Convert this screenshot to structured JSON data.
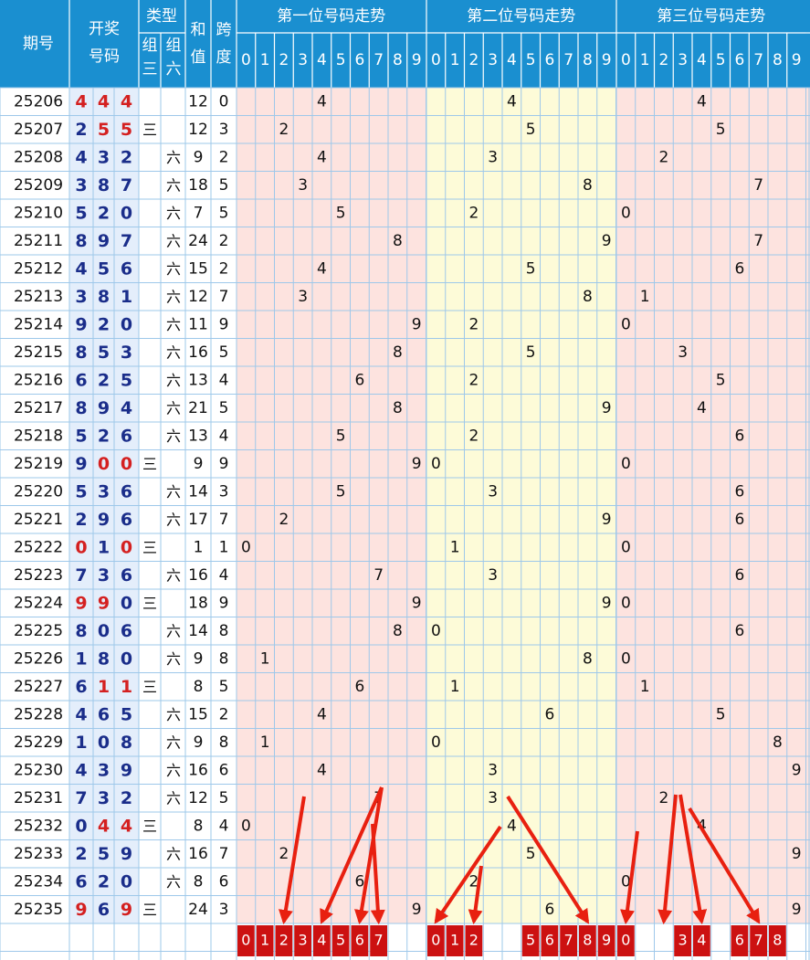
{
  "header": {
    "period_label": "期号",
    "draw_label_line1": "开奖",
    "draw_label_line2": "号码",
    "type_label": "类型",
    "type_z3": [
      "组",
      "三"
    ],
    "type_z6": [
      "组",
      "六"
    ],
    "sum_label": [
      "和",
      "值"
    ],
    "span_label": [
      "跨",
      "度"
    ],
    "pos1_title": "第一位号码走势",
    "pos2_title": "第二位号码走势",
    "pos3_title": "第三位号码走势",
    "digits": [
      "0",
      "1",
      "2",
      "3",
      "4",
      "5",
      "6",
      "7",
      "8",
      "9"
    ]
  },
  "colors": {
    "header_bg": "#1a8fd0",
    "header_border": "#ffffff",
    "grid_line": "#9ec8ea",
    "pos1_bg": "#fde3df",
    "pos2_bg": "#fdfbd8",
    "pos3_bg": "#fde3df",
    "num_blue": "#1a2d8a",
    "num_red": "#d42020",
    "draw_bg": "#e4eefb",
    "chosen_bg": "#cc1111",
    "arrow": "#e82010"
  },
  "chart_data": {
    "type": "table",
    "rows": [
      {
        "period": "25206",
        "nums": [
          "4",
          "4",
          "4"
        ],
        "z3": "",
        "z6": "",
        "sum": "12",
        "span": "0"
      },
      {
        "period": "25207",
        "nums": [
          "2",
          "5",
          "5"
        ],
        "z3": "三",
        "z6": "",
        "sum": "12",
        "span": "3"
      },
      {
        "period": "25208",
        "nums": [
          "4",
          "3",
          "2"
        ],
        "z3": "",
        "z6": "六",
        "sum": "9",
        "span": "2"
      },
      {
        "period": "25209",
        "nums": [
          "3",
          "8",
          "7"
        ],
        "z3": "",
        "z6": "六",
        "sum": "18",
        "span": "5"
      },
      {
        "period": "25210",
        "nums": [
          "5",
          "2",
          "0"
        ],
        "z3": "",
        "z6": "六",
        "sum": "7",
        "span": "5"
      },
      {
        "period": "25211",
        "nums": [
          "8",
          "9",
          "7"
        ],
        "z3": "",
        "z6": "六",
        "sum": "24",
        "span": "2"
      },
      {
        "period": "25212",
        "nums": [
          "4",
          "5",
          "6"
        ],
        "z3": "",
        "z6": "六",
        "sum": "15",
        "span": "2"
      },
      {
        "period": "25213",
        "nums": [
          "3",
          "8",
          "1"
        ],
        "z3": "",
        "z6": "六",
        "sum": "12",
        "span": "7"
      },
      {
        "period": "25214",
        "nums": [
          "9",
          "2",
          "0"
        ],
        "z3": "",
        "z6": "六",
        "sum": "11",
        "span": "9"
      },
      {
        "period": "25215",
        "nums": [
          "8",
          "5",
          "3"
        ],
        "z3": "",
        "z6": "六",
        "sum": "16",
        "span": "5"
      },
      {
        "period": "25216",
        "nums": [
          "6",
          "2",
          "5"
        ],
        "z3": "",
        "z6": "六",
        "sum": "13",
        "span": "4"
      },
      {
        "period": "25217",
        "nums": [
          "8",
          "9",
          "4"
        ],
        "z3": "",
        "z6": "六",
        "sum": "21",
        "span": "5"
      },
      {
        "period": "25218",
        "nums": [
          "5",
          "2",
          "6"
        ],
        "z3": "",
        "z6": "六",
        "sum": "13",
        "span": "4"
      },
      {
        "period": "25219",
        "nums": [
          "9",
          "0",
          "0"
        ],
        "z3": "三",
        "z6": "",
        "sum": "9",
        "span": "9"
      },
      {
        "period": "25220",
        "nums": [
          "5",
          "3",
          "6"
        ],
        "z3": "",
        "z6": "六",
        "sum": "14",
        "span": "3"
      },
      {
        "period": "25221",
        "nums": [
          "2",
          "9",
          "6"
        ],
        "z3": "",
        "z6": "六",
        "sum": "17",
        "span": "7"
      },
      {
        "period": "25222",
        "nums": [
          "0",
          "1",
          "0"
        ],
        "z3": "三",
        "z6": "",
        "sum": "1",
        "span": "1"
      },
      {
        "period": "25223",
        "nums": [
          "7",
          "3",
          "6"
        ],
        "z3": "",
        "z6": "六",
        "sum": "16",
        "span": "4"
      },
      {
        "period": "25224",
        "nums": [
          "9",
          "9",
          "0"
        ],
        "z3": "三",
        "z6": "",
        "sum": "18",
        "span": "9"
      },
      {
        "period": "25225",
        "nums": [
          "8",
          "0",
          "6"
        ],
        "z3": "",
        "z6": "六",
        "sum": "14",
        "span": "8"
      },
      {
        "period": "25226",
        "nums": [
          "1",
          "8",
          "0"
        ],
        "z3": "",
        "z6": "六",
        "sum": "9",
        "span": "8"
      },
      {
        "period": "25227",
        "nums": [
          "6",
          "1",
          "1"
        ],
        "z3": "三",
        "z6": "",
        "sum": "8",
        "span": "5"
      },
      {
        "period": "25228",
        "nums": [
          "4",
          "6",
          "5"
        ],
        "z3": "",
        "z6": "六",
        "sum": "15",
        "span": "2"
      },
      {
        "period": "25229",
        "nums": [
          "1",
          "0",
          "8"
        ],
        "z3": "",
        "z6": "六",
        "sum": "9",
        "span": "8"
      },
      {
        "period": "25230",
        "nums": [
          "4",
          "3",
          "9"
        ],
        "z3": "",
        "z6": "六",
        "sum": "16",
        "span": "6"
      },
      {
        "period": "25231",
        "nums": [
          "7",
          "3",
          "2"
        ],
        "z3": "",
        "z6": "六",
        "sum": "12",
        "span": "5"
      },
      {
        "period": "25232",
        "nums": [
          "0",
          "4",
          "4"
        ],
        "z3": "三",
        "z6": "",
        "sum": "8",
        "span": "4"
      },
      {
        "period": "25233",
        "nums": [
          "2",
          "5",
          "9"
        ],
        "z3": "",
        "z6": "六",
        "sum": "16",
        "span": "7"
      },
      {
        "period": "25234",
        "nums": [
          "6",
          "2",
          "0"
        ],
        "z3": "",
        "z6": "六",
        "sum": "8",
        "span": "6"
      },
      {
        "period": "25235",
        "nums": [
          "9",
          "6",
          "9"
        ],
        "z3": "三",
        "z6": "",
        "sum": "24",
        "span": "3"
      }
    ],
    "selected": {
      "pos1": [
        "0",
        "1",
        "2",
        "3",
        "4",
        "5",
        "6",
        "7"
      ],
      "pos2": [
        "0",
        "1",
        "2",
        "5",
        "6",
        "7",
        "8",
        "9"
      ],
      "pos3": [
        "0",
        "3",
        "4",
        "6",
        "7",
        "8"
      ]
    },
    "arrows": [
      {
        "pos": 1,
        "digit": "2"
      },
      {
        "pos": 1,
        "digit": "4"
      },
      {
        "pos": 1,
        "digit": "6"
      },
      {
        "pos": 1,
        "digit": "7"
      },
      {
        "pos": 2,
        "digit": "0"
      },
      {
        "pos": 2,
        "digit": "2"
      },
      {
        "pos": 2,
        "digit": "8"
      },
      {
        "pos": 3,
        "digit": "0"
      },
      {
        "pos": 3,
        "digit": "2"
      },
      {
        "pos": 3,
        "digit": "4"
      },
      {
        "pos": 3,
        "digit": "7"
      }
    ]
  }
}
